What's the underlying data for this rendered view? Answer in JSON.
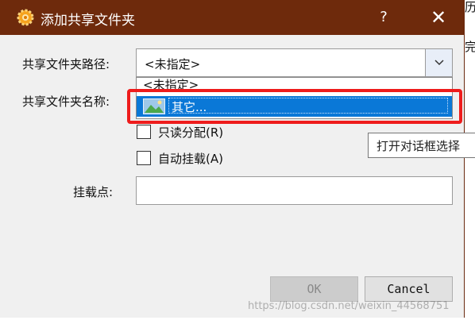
{
  "colors": {
    "titlebar": "#6e2a0c",
    "selection": "#0a78d7",
    "highlight_box": "#ee1c1c"
  },
  "dialog": {
    "title": "添加共享文件夹",
    "help_label": "?",
    "close_label": "✕"
  },
  "form": {
    "path_label": "共享文件夹路径:",
    "path_value": "<未指定>",
    "name_label": "共享文件夹名称:",
    "readonly_label": "只读分配(R)",
    "automount_label": "自动挂载(A)",
    "mountpoint_label": "挂载点:",
    "mountpoint_value": ""
  },
  "dropdown": {
    "items": [
      {
        "label": "<未指定>"
      },
      {
        "label": "其它...",
        "icon": "folder-image-icon"
      }
    ]
  },
  "tooltip": {
    "text": "打开对话框选择"
  },
  "buttons": {
    "ok_label": "OK",
    "cancel_label": "Cancel"
  },
  "background_page": {
    "frag_top": "历",
    "frag_mid": "完"
  },
  "watermark": "https://blog.csdn.net/weixin_44568751"
}
